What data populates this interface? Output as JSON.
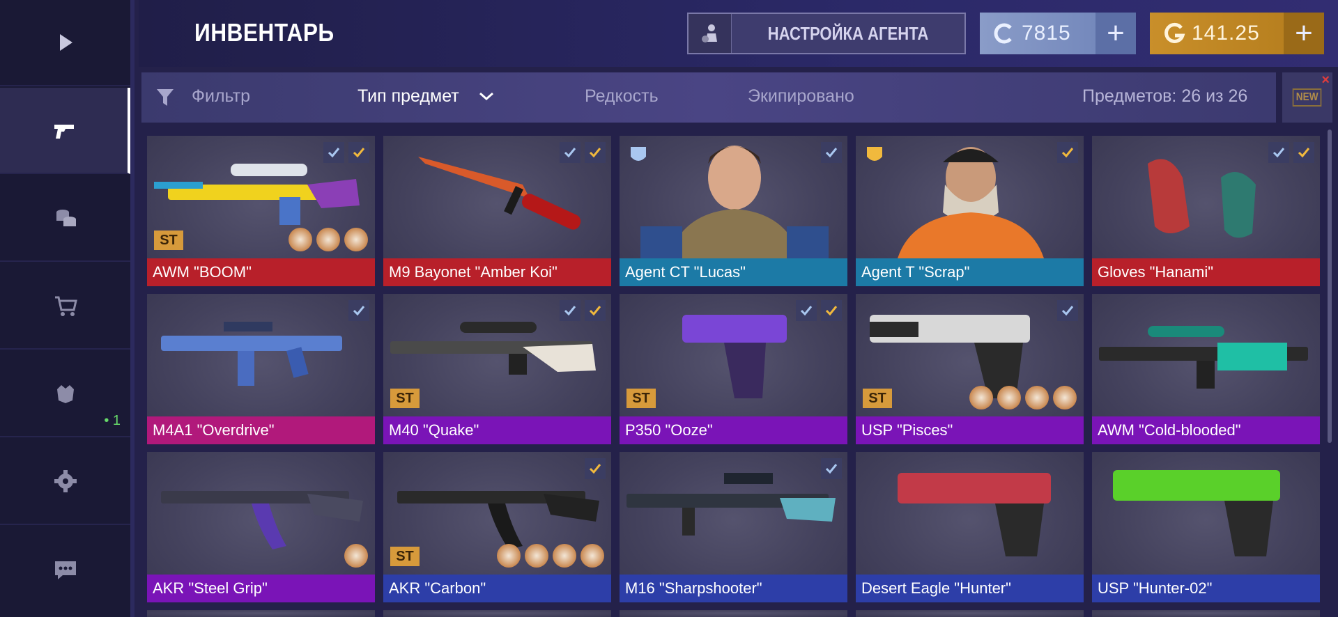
{
  "sidebar": {
    "items": [
      {
        "icon": "play-icon"
      },
      {
        "icon": "pistol-icon",
        "active": true
      },
      {
        "icon": "coins-icon"
      },
      {
        "icon": "cart-icon"
      },
      {
        "icon": "clan-shield-icon",
        "badge": "• 1"
      },
      {
        "icon": "gear-icon"
      },
      {
        "icon": "chat-icon"
      }
    ]
  },
  "header": {
    "title": "ИНВЕНТАРЬ",
    "agent_button": "НАСТРОЙКА АГЕНТА",
    "credits": "7815",
    "gold": "141.25",
    "plus": "+"
  },
  "filters": {
    "filter": "Фильтр",
    "type": "Тип предмет",
    "rarity": "Редкость",
    "equipped": "Экипировано",
    "count": "Предметов: 26 из 26",
    "new": "NEW",
    "new_close": "×"
  },
  "colors": {
    "red": "#b8202a",
    "blue": "#1c7aa6",
    "pink": "#b1197b",
    "purple": "#7a14b7",
    "indigo": "#2d3ea8",
    "ct": "#a9c7f0",
    "t": "#f1b93d"
  },
  "items": [
    {
      "name": "AWM \"BOOM\"",
      "rarity": "red",
      "st": "ST",
      "checks": [
        "ct",
        "t"
      ],
      "stickers": 3,
      "art": "sniper"
    },
    {
      "name": "M9 Bayonet \"Amber Koi\"",
      "rarity": "red",
      "checks": [
        "ct",
        "t"
      ],
      "art": "knife"
    },
    {
      "name": "Agent CT \"Lucas\"",
      "rarity": "blue",
      "team": "ct",
      "checks": [
        "ct"
      ],
      "art": "agent-ct"
    },
    {
      "name": "Agent T \"Scrap\"",
      "rarity": "blue",
      "team": "t",
      "checks": [
        "t"
      ],
      "art": "agent-t"
    },
    {
      "name": "Gloves \"Hanami\"",
      "rarity": "red",
      "checks": [
        "ct",
        "t"
      ],
      "art": "gloves"
    },
    {
      "name": "M4A1 \"Overdrive\"",
      "rarity": "pink",
      "checks": [
        "ct"
      ],
      "art": "rifle"
    },
    {
      "name": "M40 \"Quake\"",
      "rarity": "purple",
      "st": "ST",
      "checks": [
        "ct",
        "t"
      ],
      "art": "sniper2"
    },
    {
      "name": "P350 \"Ooze\"",
      "rarity": "purple",
      "st": "ST",
      "checks": [
        "ct",
        "t"
      ],
      "art": "pistol"
    },
    {
      "name": "USP \"Pisces\"",
      "rarity": "purple",
      "st": "ST",
      "checks": [
        "ct"
      ],
      "stickers": 4,
      "art": "pistol2"
    },
    {
      "name": "AWM \"Cold-blooded\"",
      "rarity": "purple",
      "checks": [],
      "art": "sniper3"
    },
    {
      "name": "AKR \"Steel Grip\"",
      "rarity": "purple",
      "checks": [],
      "stickers": 1,
      "art": "ak"
    },
    {
      "name": "AKR \"Carbon\"",
      "rarity": "indigo",
      "st": "ST",
      "checks": [
        "t"
      ],
      "stickers": 4,
      "art": "ak2"
    },
    {
      "name": "M16 \"Sharpshooter\"",
      "rarity": "indigo",
      "checks": [
        "ct"
      ],
      "art": "m16"
    },
    {
      "name": "Desert Eagle \"Hunter\"",
      "rarity": "indigo",
      "checks": [],
      "art": "deagle"
    },
    {
      "name": "USP \"Hunter-02\"",
      "rarity": "indigo",
      "checks": [],
      "art": "pistol3"
    }
  ]
}
